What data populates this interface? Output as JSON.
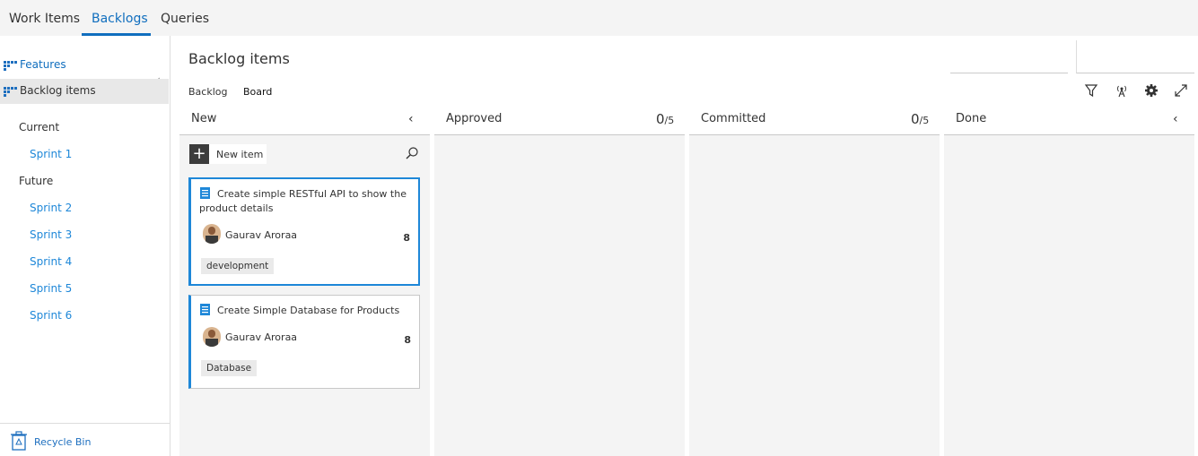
{
  "topnav": {
    "tabs": [
      {
        "label": "Work Items"
      },
      {
        "label": "Backlogs",
        "active": true
      },
      {
        "label": "Queries"
      }
    ]
  },
  "sidebar": {
    "collapse_icon": "chevron-left-icon",
    "items": [
      {
        "label": "Features",
        "icon": "backlog-icon"
      },
      {
        "label": "Backlog items",
        "icon": "backlog-icon",
        "selected": true
      }
    ],
    "current": {
      "label": "Current",
      "sprints": [
        "Sprint 1"
      ]
    },
    "future": {
      "label": "Future",
      "sprints": [
        "Sprint 2",
        "Sprint 3",
        "Sprint 4",
        "Sprint 5",
        "Sprint 6"
      ]
    },
    "recycle_bin": "Recycle Bin"
  },
  "main": {
    "title": "Backlog items",
    "subtabs": [
      {
        "label": "Backlog"
      },
      {
        "label": "Board",
        "active": true
      }
    ],
    "toolbar": [
      "filter-icon",
      "live-updates-icon",
      "settings-gear-icon",
      "fullscreen-icon"
    ]
  },
  "board": {
    "columns": [
      {
        "title": "New"
      },
      {
        "title": "Approved",
        "count": "0",
        "limit": "/5"
      },
      {
        "title": "Committed",
        "count": "0",
        "limit": "/5"
      },
      {
        "title": "Done"
      }
    ],
    "new_item_label": "New item",
    "cards": [
      {
        "title": "Create simple RESTful API to show the product details",
        "assignee": "Gaurav Aroraa",
        "effort": "8",
        "tag": "development",
        "selected": true
      },
      {
        "title": "Create Simple Database for Products",
        "assignee": "Gaurav Aroraa",
        "effort": "8",
        "tag": "Database"
      }
    ]
  },
  "colors": {
    "accent": "#106ebe",
    "card_border": "#1e87d8",
    "column_bg": "#f4f4f4"
  }
}
